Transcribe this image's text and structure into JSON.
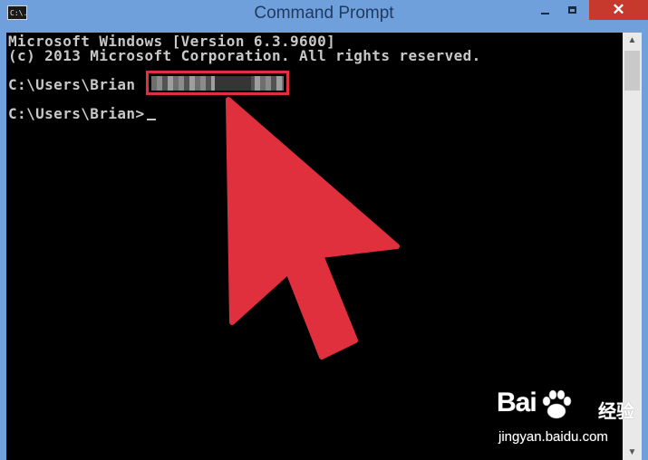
{
  "window": {
    "title": "Command Prompt",
    "icon_label": "C:\\."
  },
  "controls": {
    "minimize_icon": "minimize-icon",
    "maximize_icon": "maximize-icon",
    "close_glyph": "✕"
  },
  "console": {
    "lines": [
      "Microsoft Windows [Version 6.3.9600]",
      "(c) 2013 Microsoft Corporation. All rights reserved.",
      "C:\\Users\\Brian",
      "C:\\Users\\Brian>"
    ]
  },
  "scrollbar": {
    "up_glyph": "▲",
    "down_glyph": "▼"
  },
  "annotation": {
    "arrow_color": "#e0303d",
    "box_color": "#e0303d"
  },
  "watermark": {
    "logo": "Bai",
    "logo_suffix": "经验",
    "url": "jingyan.baidu.com"
  },
  "colors": {
    "titlebar": "#6fa0dc",
    "console_bg": "#000000",
    "console_text": "#c8c8c8",
    "close_button": "#c7392c"
  }
}
